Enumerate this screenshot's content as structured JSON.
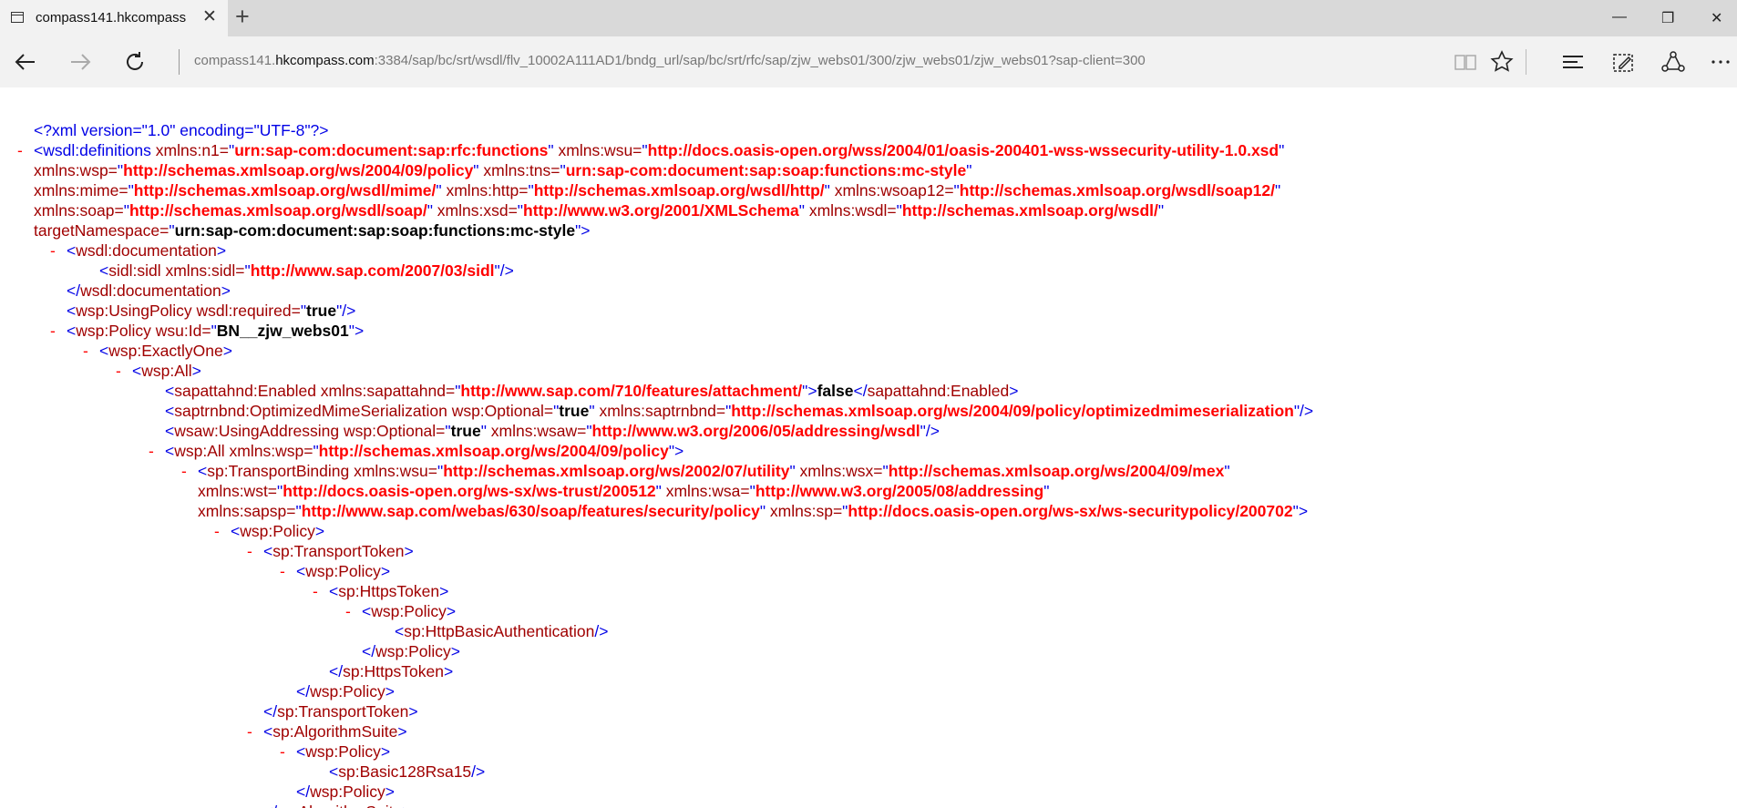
{
  "browser": {
    "tab_title": "compass141.hkcompass",
    "address": {
      "prefix": "compass141.",
      "domain": "hkcompass.com",
      "suffix": ":3384/sap/bc/srt/wsdl/flv_10002A111AD1/bndg_url/sap/bc/srt/rfc/sap/zjw_webs01/300/zjw_webs01/zjw_webs01?sap-client=300"
    },
    "window_controls": {
      "minimize": "—",
      "restore": "❐",
      "close": "✕"
    }
  },
  "xml": {
    "decl": "<?xml version=\"1.0\" encoding=\"UTF-8\"?>",
    "collapse_marker": "-",
    "lines": [
      [
        [
          "tg",
          "<wsdl:definitions "
        ],
        [
          "at",
          "xmlns:n1="
        ],
        [
          "tg",
          "\""
        ],
        [
          "vl",
          "urn:sap-com:document:sap:rfc:functions"
        ],
        [
          "tg",
          "\" "
        ],
        [
          "at",
          "xmlns:wsu="
        ],
        [
          "tg",
          "\""
        ],
        [
          "vl",
          "http://docs.oasis-open.org/wss/2004/01/oasis-200401-wss-wssecurity-utility-1.0.xsd"
        ],
        [
          "tg",
          "\""
        ]
      ],
      [
        [
          "at",
          "xmlns:wsp="
        ],
        [
          "tg",
          "\""
        ],
        [
          "vl",
          "http://schemas.xmlsoap.org/ws/2004/09/policy"
        ],
        [
          "tg",
          "\" "
        ],
        [
          "at",
          "xmlns:tns="
        ],
        [
          "tg",
          "\""
        ],
        [
          "vl",
          "urn:sap-com:document:sap:soap:functions:mc-style"
        ],
        [
          "tg",
          "\""
        ]
      ],
      [
        [
          "at",
          "xmlns:mime="
        ],
        [
          "tg",
          "\""
        ],
        [
          "vl",
          "http://schemas.xmlsoap.org/wsdl/mime/"
        ],
        [
          "tg",
          "\" "
        ],
        [
          "at",
          "xmlns:http="
        ],
        [
          "tg",
          "\""
        ],
        [
          "vl",
          "http://schemas.xmlsoap.org/wsdl/http/"
        ],
        [
          "tg",
          "\" "
        ],
        [
          "at",
          "xmlns:wsoap12="
        ],
        [
          "tg",
          "\""
        ],
        [
          "vl",
          "http://schemas.xmlsoap.org/wsdl/soap12/"
        ],
        [
          "tg",
          "\""
        ]
      ],
      [
        [
          "at",
          "xmlns:soap="
        ],
        [
          "tg",
          "\""
        ],
        [
          "vl",
          "http://schemas.xmlsoap.org/wsdl/soap/"
        ],
        [
          "tg",
          "\" "
        ],
        [
          "at",
          "xmlns:xsd="
        ],
        [
          "tg",
          "\""
        ],
        [
          "vl",
          "http://www.w3.org/2001/XMLSchema"
        ],
        [
          "tg",
          "\" "
        ],
        [
          "at",
          "xmlns:wsdl="
        ],
        [
          "tg",
          "\""
        ],
        [
          "vl",
          "http://schemas.xmlsoap.org/wsdl/"
        ],
        [
          "tg",
          "\""
        ]
      ],
      [
        [
          "at",
          "targetNamespace="
        ],
        [
          "tg",
          "\""
        ],
        [
          "vlb",
          "urn:sap-com:document:sap:soap:functions:mc-style"
        ],
        [
          "tg",
          "\">"
        ]
      ],
      [
        [
          "tg",
          "<"
        ],
        [
          "at",
          "wsdl:documentation"
        ],
        [
          "tg",
          ">"
        ]
      ],
      [
        [
          "tg",
          "<"
        ],
        [
          "at",
          "sidl:sidl "
        ],
        [
          "at",
          "xmlns:sidl="
        ],
        [
          "tg",
          "\""
        ],
        [
          "vl",
          "http://www.sap.com/2007/03/sidl"
        ],
        [
          "tg",
          "\"/>"
        ]
      ],
      [
        [
          "tg",
          "</"
        ],
        [
          "at",
          "wsdl:documentation"
        ],
        [
          "tg",
          ">"
        ]
      ],
      [
        [
          "tg",
          "<"
        ],
        [
          "at",
          "wsp:UsingPolicy "
        ],
        [
          "at",
          "wsdl:required="
        ],
        [
          "tg",
          "\""
        ],
        [
          "vlb",
          "true"
        ],
        [
          "tg",
          "\"/>"
        ]
      ],
      [
        [
          "tg",
          "<"
        ],
        [
          "at",
          "wsp:Policy "
        ],
        [
          "at",
          "wsu:Id="
        ],
        [
          "tg",
          "\""
        ],
        [
          "vlb",
          "BN__zjw_webs01"
        ],
        [
          "tg",
          "\">"
        ]
      ],
      [
        [
          "tg",
          "<"
        ],
        [
          "at",
          "wsp:ExactlyOne"
        ],
        [
          "tg",
          ">"
        ]
      ],
      [
        [
          "tg",
          "<"
        ],
        [
          "at",
          "wsp:All"
        ],
        [
          "tg",
          ">"
        ]
      ],
      [
        [
          "tg",
          "<"
        ],
        [
          "at",
          "sapattahnd:Enabled "
        ],
        [
          "at",
          "xmlns:sapattahnd="
        ],
        [
          "tg",
          "\""
        ],
        [
          "vl",
          "http://www.sap.com/710/features/attachment/"
        ],
        [
          "tg",
          "\">"
        ],
        [
          "tx",
          "false"
        ],
        [
          "tg",
          "</"
        ],
        [
          "at",
          "sapattahnd:Enabled"
        ],
        [
          "tg",
          ">"
        ]
      ],
      [
        [
          "tg",
          "<"
        ],
        [
          "at",
          "saptrnbnd:OptimizedMimeSerialization "
        ],
        [
          "at",
          "wsp:Optional="
        ],
        [
          "tg",
          "\""
        ],
        [
          "vlb",
          "true"
        ],
        [
          "tg",
          "\" "
        ],
        [
          "at",
          "xmlns:saptrnbnd="
        ],
        [
          "tg",
          "\""
        ],
        [
          "vl",
          "http://schemas.xmlsoap.org/ws/2004/09/policy/optimizedmimeserialization"
        ],
        [
          "tg",
          "\"/>"
        ]
      ],
      [
        [
          "tg",
          "<"
        ],
        [
          "at",
          "wsaw:UsingAddressing "
        ],
        [
          "at",
          "wsp:Optional="
        ],
        [
          "tg",
          "\""
        ],
        [
          "vlb",
          "true"
        ],
        [
          "tg",
          "\" "
        ],
        [
          "at",
          "xmlns:wsaw="
        ],
        [
          "tg",
          "\""
        ],
        [
          "vl",
          "http://www.w3.org/2006/05/addressing/wsdl"
        ],
        [
          "tg",
          "\"/>"
        ]
      ],
      [
        [
          "tg",
          "<"
        ],
        [
          "at",
          "wsp:All "
        ],
        [
          "at",
          "xmlns:wsp="
        ],
        [
          "tg",
          "\""
        ],
        [
          "vl",
          "http://schemas.xmlsoap.org/ws/2004/09/policy"
        ],
        [
          "tg",
          "\">"
        ]
      ],
      [
        [
          "tg",
          "<"
        ],
        [
          "at",
          "sp:TransportBinding "
        ],
        [
          "at",
          "xmlns:wsu="
        ],
        [
          "tg",
          "\""
        ],
        [
          "vl",
          "http://schemas.xmlsoap.org/ws/2002/07/utility"
        ],
        [
          "tg",
          "\" "
        ],
        [
          "at",
          "xmlns:wsx="
        ],
        [
          "tg",
          "\""
        ],
        [
          "vl",
          "http://schemas.xmlsoap.org/ws/2004/09/mex"
        ],
        [
          "tg",
          "\""
        ]
      ],
      [
        [
          "at",
          "xmlns:wst="
        ],
        [
          "tg",
          "\""
        ],
        [
          "vl",
          "http://docs.oasis-open.org/ws-sx/ws-trust/200512"
        ],
        [
          "tg",
          "\" "
        ],
        [
          "at",
          "xmlns:wsa="
        ],
        [
          "tg",
          "\""
        ],
        [
          "vl",
          "http://www.w3.org/2005/08/addressing"
        ],
        [
          "tg",
          "\""
        ]
      ],
      [
        [
          "at",
          "xmlns:sapsp="
        ],
        [
          "tg",
          "\""
        ],
        [
          "vl",
          "http://www.sap.com/webas/630/soap/features/security/policy"
        ],
        [
          "tg",
          "\" "
        ],
        [
          "at",
          "xmlns:sp="
        ],
        [
          "tg",
          "\""
        ],
        [
          "vl",
          "http://docs.oasis-open.org/ws-sx/ws-securitypolicy/200702"
        ],
        [
          "tg",
          "\">"
        ]
      ],
      [
        [
          "tg",
          "<"
        ],
        [
          "at",
          "wsp:Policy"
        ],
        [
          "tg",
          ">"
        ]
      ],
      [
        [
          "tg",
          "<"
        ],
        [
          "at",
          "sp:TransportToken"
        ],
        [
          "tg",
          ">"
        ]
      ],
      [
        [
          "tg",
          "<"
        ],
        [
          "at",
          "wsp:Policy"
        ],
        [
          "tg",
          ">"
        ]
      ],
      [
        [
          "tg",
          "<"
        ],
        [
          "at",
          "sp:HttpsToken"
        ],
        [
          "tg",
          ">"
        ]
      ],
      [
        [
          "tg",
          "<"
        ],
        [
          "at",
          "wsp:Policy"
        ],
        [
          "tg",
          ">"
        ]
      ],
      [
        [
          "tg",
          "<"
        ],
        [
          "at",
          "sp:HttpBasicAuthentication"
        ],
        [
          "tg",
          "/>"
        ]
      ],
      [
        [
          "tg",
          "</"
        ],
        [
          "at",
          "wsp:Policy"
        ],
        [
          "tg",
          ">"
        ]
      ],
      [
        [
          "tg",
          "</"
        ],
        [
          "at",
          "sp:HttpsToken"
        ],
        [
          "tg",
          ">"
        ]
      ],
      [
        [
          "tg",
          "</"
        ],
        [
          "at",
          "wsp:Policy"
        ],
        [
          "tg",
          ">"
        ]
      ],
      [
        [
          "tg",
          "</"
        ],
        [
          "at",
          "sp:TransportToken"
        ],
        [
          "tg",
          ">"
        ]
      ],
      [
        [
          "tg",
          "<"
        ],
        [
          "at",
          "sp:AlgorithmSuite"
        ],
        [
          "tg",
          ">"
        ]
      ],
      [
        [
          "tg",
          "<"
        ],
        [
          "at",
          "wsp:Policy"
        ],
        [
          "tg",
          ">"
        ]
      ],
      [
        [
          "tg",
          "<"
        ],
        [
          "at",
          "sp:Basic128Rsa15"
        ],
        [
          "tg",
          "/>"
        ]
      ],
      [
        [
          "tg",
          "</"
        ],
        [
          "at",
          "wsp:Policy"
        ],
        [
          "tg",
          ">"
        ]
      ],
      [
        [
          "tg",
          "</"
        ],
        [
          "at",
          "sp:AlgorithmSuite"
        ],
        [
          "tg",
          ">"
        ]
      ]
    ]
  }
}
